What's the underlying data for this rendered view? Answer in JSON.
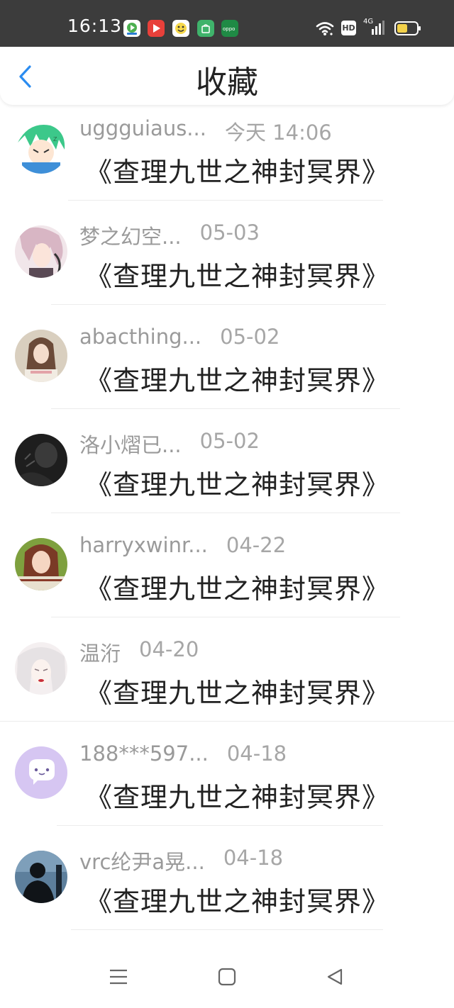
{
  "status_bar": {
    "time": "16:13",
    "network_label": "4G",
    "hd_label": "HD",
    "app_icons": [
      {
        "name": "video-app-icon",
        "color": "#4cb050"
      },
      {
        "name": "play-app-icon",
        "color": "#e8403a"
      },
      {
        "name": "emoji-app-icon",
        "color": "#f6d84a"
      },
      {
        "name": "store-app-icon",
        "color": "#3fb36b"
      },
      {
        "name": "oppo-app-icon",
        "color": "#1f8a45"
      }
    ]
  },
  "header": {
    "title": "收藏",
    "back_icon": "chevron-left-icon",
    "accent_color": "#2b8cf0"
  },
  "items": [
    {
      "user": "uggguiaus...",
      "date": "今天 14:06",
      "title": "《查理九世之神封冥界》",
      "avatar": "green-anime-avatar"
    },
    {
      "user": "梦之幻空...",
      "date": "05-03",
      "title": "《查理九世之神封冥界》",
      "avatar": "pink-hair-anime-avatar"
    },
    {
      "user": "abacthing...",
      "date": "05-02",
      "title": "《查理九世之神封冥界》",
      "avatar": "girl-photo-avatar"
    },
    {
      "user": "洛小熠已...",
      "date": "05-02",
      "title": "《查理九世之神封冥界》",
      "avatar": "dark-photo-avatar"
    },
    {
      "user": "harryxwinr...",
      "date": "04-22",
      "title": "《查理九世之神封冥界》",
      "avatar": "portrait-photo-avatar"
    },
    {
      "user": "温洐",
      "date": "04-20",
      "title": "《查理九世之神封冥界》",
      "avatar": "white-hair-anime-avatar"
    },
    {
      "user": "188***597...",
      "date": "04-18",
      "title": "《查理九世之神封冥界》",
      "avatar": "purple-chat-avatar"
    },
    {
      "user": "vrc纶尹a晃...",
      "date": "04-18",
      "title": "《查理九世之神封冥界》",
      "avatar": "silhouette-avatar"
    }
  ],
  "nav": {
    "menu_icon": "menu-icon",
    "home_icon": "home-square-icon",
    "back_icon": "back-triangle-icon"
  }
}
